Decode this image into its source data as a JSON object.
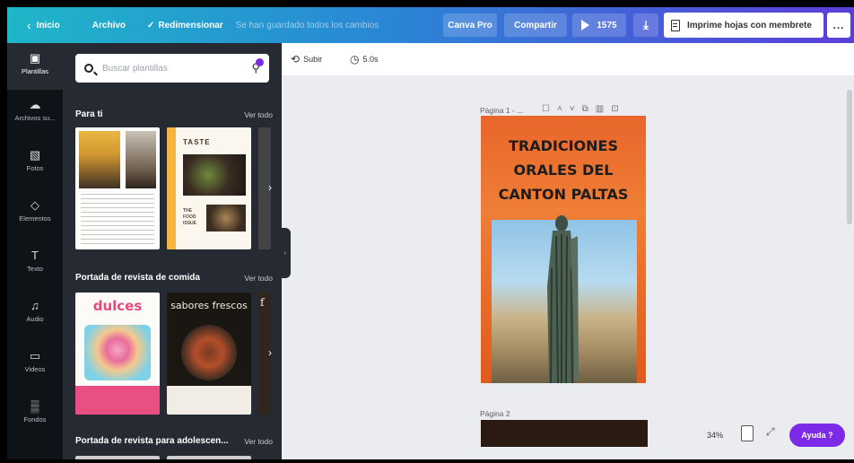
{
  "topbar": {
    "back_label": "Inicio",
    "file_label": "Archivo",
    "resize_label": "Redimensionar",
    "saved_status": "Se han guardado todos los cambios",
    "pro_label": "Canva Pro",
    "share_label": "Compartir",
    "present_count": "1575",
    "print_label": "Imprime hojas con membrete",
    "more_label": "..."
  },
  "rail": [
    {
      "icon": "template-icon",
      "label": "Plantillas"
    },
    {
      "icon": "upload-icon",
      "label": "Archivos su..."
    },
    {
      "icon": "photo-icon",
      "label": "Fotos"
    },
    {
      "icon": "elements-icon",
      "label": "Elementos"
    },
    {
      "icon": "text-icon",
      "label": "Texto"
    },
    {
      "icon": "audio-icon",
      "label": "Audio"
    },
    {
      "icon": "video-icon",
      "label": "Videos"
    },
    {
      "icon": "background-icon",
      "label": "Fondos"
    }
  ],
  "panel": {
    "search_placeholder": "Buscar plantillas",
    "sections": [
      {
        "title": "Para ti",
        "link": "Ver todo"
      },
      {
        "title": "Portada de revista de comida",
        "link": "Ver todo"
      },
      {
        "title": "Portada de revista para adolescen...",
        "link": "Ver todo"
      }
    ],
    "thumb_texts": {
      "taste": "TASTE",
      "thumb_small": "THE FOOD ISSUE",
      "dulces": "dulces",
      "sabores": "sabores frescos",
      "f": "f"
    }
  },
  "canvas": {
    "upload_label": "Subir",
    "timer_label": "5.0s",
    "page1_label": "Página 1 - ...",
    "page2_label": "Página 2",
    "title": "TRADICIONES ORALES DEL CANTON PALTAS",
    "zoom": "34%",
    "help_label": "Ayuda ?"
  }
}
